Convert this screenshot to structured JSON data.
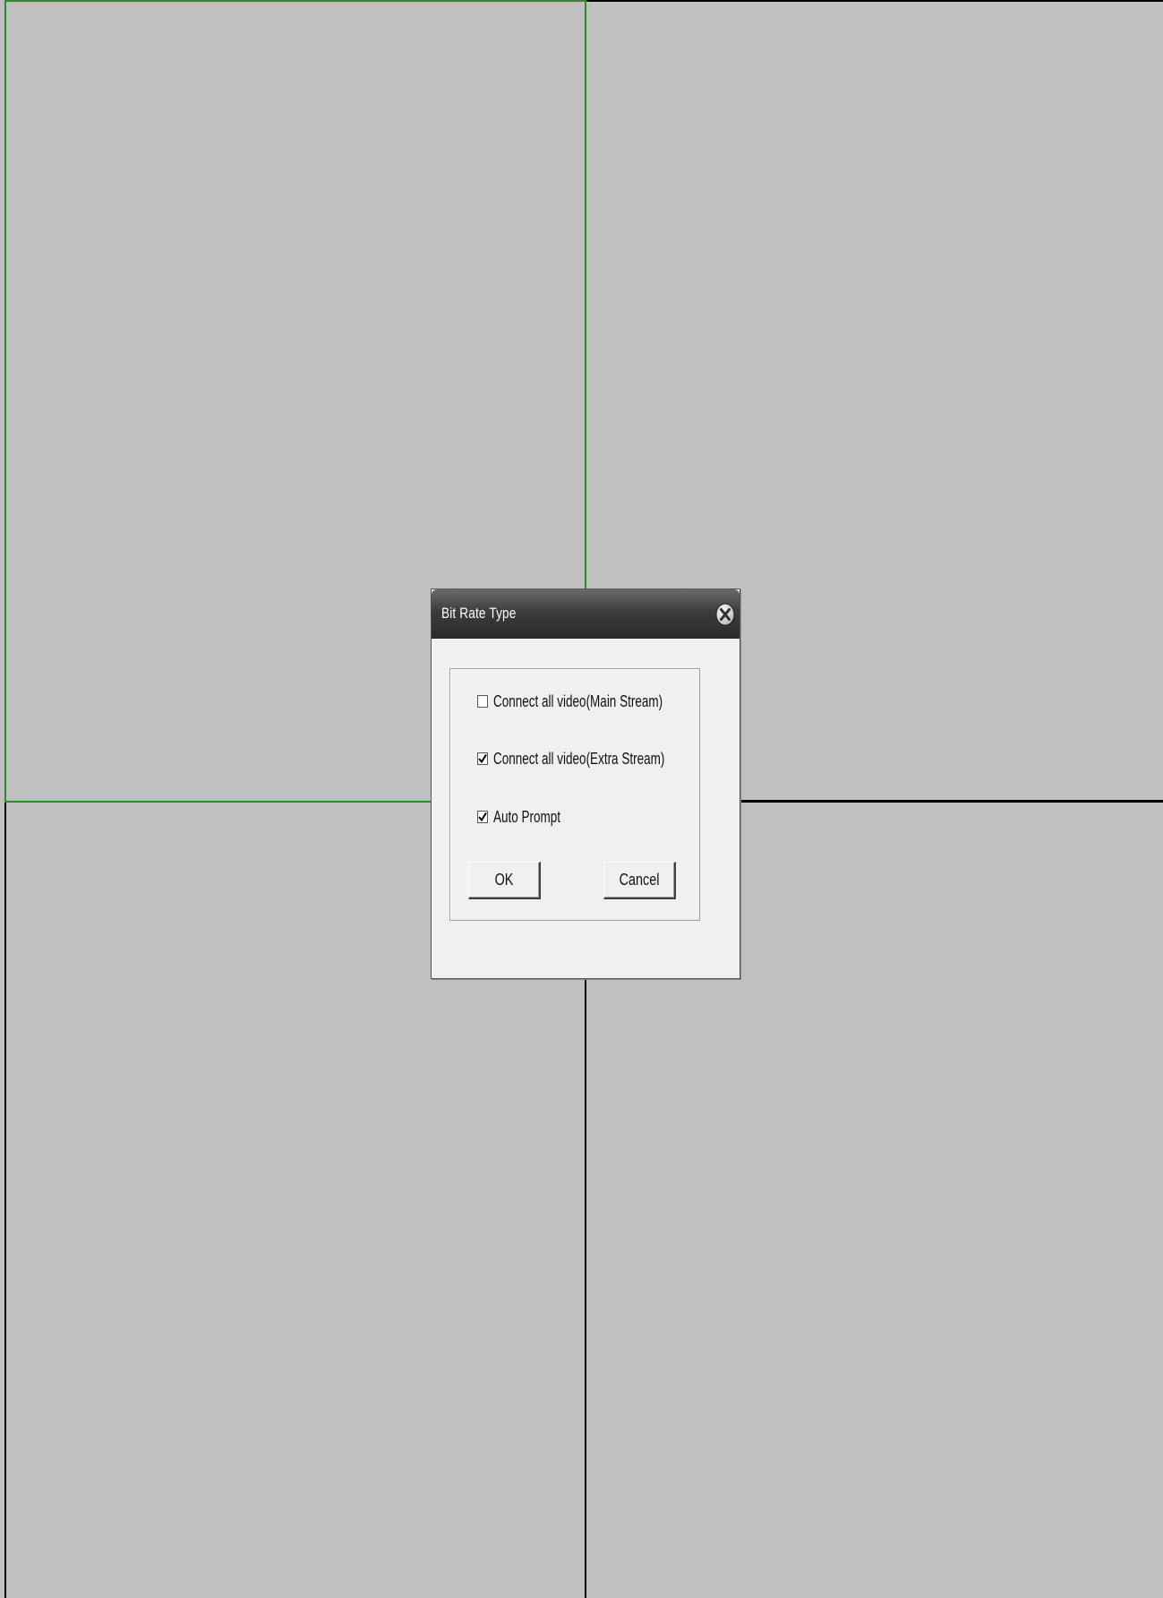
{
  "background_color": "#c0c0c0",
  "selected_pane_border_color": "#2e8b2e",
  "dialog": {
    "title": "Bit Rate Type",
    "close_icon": "close-circle-icon",
    "options": [
      {
        "label": "Connect all video(Main Stream)",
        "checked": false
      },
      {
        "label": "Connect all video(Extra Stream)",
        "checked": true
      },
      {
        "label": "Auto Prompt",
        "checked": true
      }
    ],
    "ok_label": "OK",
    "cancel_label": "Cancel"
  }
}
